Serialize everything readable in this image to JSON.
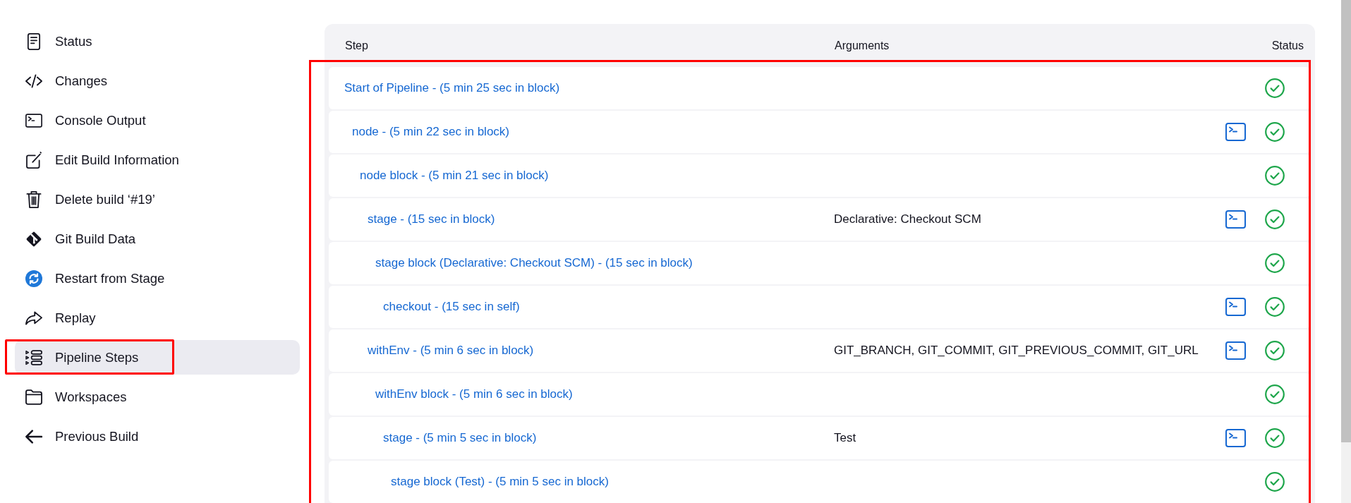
{
  "sidebar": {
    "items": [
      {
        "kind": "status",
        "label": "Status",
        "selected": false,
        "highlighted": false
      },
      {
        "kind": "changes",
        "label": "Changes",
        "selected": false,
        "highlighted": false
      },
      {
        "kind": "console",
        "label": "Console Output",
        "selected": false,
        "highlighted": false
      },
      {
        "kind": "edit",
        "label": "Edit Build Information",
        "selected": false,
        "highlighted": false
      },
      {
        "kind": "delete",
        "label": "Delete build ‘#19’",
        "selected": false,
        "highlighted": false
      },
      {
        "kind": "git",
        "label": "Git Build Data",
        "selected": false,
        "highlighted": false
      },
      {
        "kind": "restart",
        "label": "Restart from Stage",
        "selected": false,
        "highlighted": false
      },
      {
        "kind": "replay",
        "label": "Replay",
        "selected": false,
        "highlighted": false
      },
      {
        "kind": "steps",
        "label": "Pipeline Steps",
        "selected": true,
        "highlighted": true
      },
      {
        "kind": "workspaces",
        "label": "Workspaces",
        "selected": false,
        "highlighted": false
      },
      {
        "kind": "previous",
        "label": "Previous Build",
        "selected": false,
        "highlighted": false
      }
    ]
  },
  "table": {
    "columns": [
      "Step",
      "Arguments",
      "Status"
    ],
    "highlighted": true,
    "steps": [
      {
        "label": "Start of Pipeline - (5 min 25 sec in block)",
        "console": false,
        "success": true,
        "children": [
          {
            "label": "node - (5 min 22 sec in block)",
            "console": true,
            "success": true,
            "children": [
              {
                "label": "node block - (5 min 21 sec in block)",
                "console": false,
                "success": true,
                "children": [
                  {
                    "label": "stage - (15 sec in block)",
                    "arguments": "Declarative: Checkout SCM",
                    "console": true,
                    "success": true,
                    "children": [
                      {
                        "label": "stage block (Declarative: Checkout SCM) - (15 sec in block)",
                        "console": false,
                        "success": true,
                        "children": [
                          {
                            "label": "checkout - (15 sec in self)",
                            "console": true,
                            "success": true
                          }
                        ]
                      }
                    ]
                  },
                  {
                    "label": "withEnv - (5 min 6 sec in block)",
                    "arguments": "GIT_BRANCH, GIT_COMMIT, GIT_PREVIOUS_COMMIT, GIT_URL",
                    "console": true,
                    "success": true,
                    "children": [
                      {
                        "label": "withEnv block - (5 min 6 sec in block)",
                        "console": false,
                        "success": true,
                        "children": [
                          {
                            "label": "stage - (5 min 5 sec in block)",
                            "arguments": "Test",
                            "console": true,
                            "success": true,
                            "children": [
                              {
                                "label": "stage block (Test) - (5 min 5 sec in block)",
                                "console": false,
                                "success": true
                              }
                            ]
                          }
                        ]
                      }
                    ]
                  }
                ]
              }
            ]
          }
        ]
      }
    ]
  }
}
